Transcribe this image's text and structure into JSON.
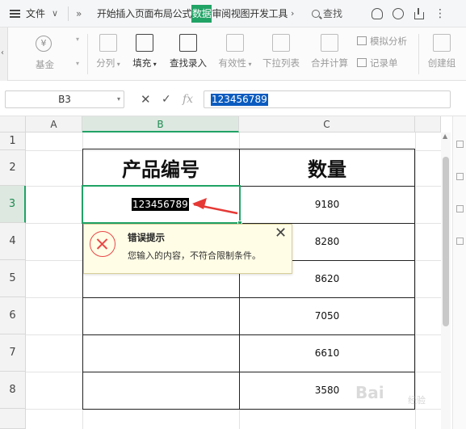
{
  "menubar": {
    "file_label": "文件",
    "tabs": [
      {
        "label": "开始",
        "active": false
      },
      {
        "label": "插入",
        "active": false
      },
      {
        "label": "页面布局",
        "active": false
      },
      {
        "label": "公式",
        "active": false
      },
      {
        "label": "数据",
        "active": true
      },
      {
        "label": "审阅",
        "active": false
      },
      {
        "label": "视图",
        "active": false
      },
      {
        "label": "开发工具",
        "active": false
      }
    ],
    "search_label": "查找"
  },
  "ribbon": {
    "currency_label": "基金",
    "currency_symbol": "¥",
    "split_label": "分列",
    "fill_label": "填充",
    "find_entry_label": "查找录入",
    "validity_label": "有效性",
    "dropdown_list_label": "下拉列表",
    "merge_calc_label": "合并计算",
    "simulate_label": "模拟分析",
    "record_label": "记录单",
    "create_group_label": "创建组"
  },
  "formula_bar": {
    "cell_ref": "B3",
    "cancel_glyph": "✕",
    "ok_glyph": "✓",
    "fx_label": "fx",
    "value": "123456789"
  },
  "sheet": {
    "columns": [
      "A",
      "B",
      "C"
    ],
    "rows": [
      "1",
      "2",
      "3",
      "4",
      "5",
      "6",
      "7",
      "8"
    ],
    "selected_column": "B",
    "selected_row": "3",
    "header_product": "产品编号",
    "header_qty": "数量",
    "quantities": [
      "9180",
      "8280",
      "8620",
      "7050",
      "6610",
      "3580"
    ],
    "active_value": "123456789"
  },
  "error_tip": {
    "title": "错误提示",
    "message": "您输入的内容，不符合限制条件。",
    "close_glyph": "✕"
  },
  "watermark": {
    "text": "Bai",
    "sub": "经验"
  },
  "colors": {
    "accent": "#21a366",
    "error": "#e94848",
    "tooltip_bg": "#fffde6",
    "arrow": "#e53935"
  }
}
